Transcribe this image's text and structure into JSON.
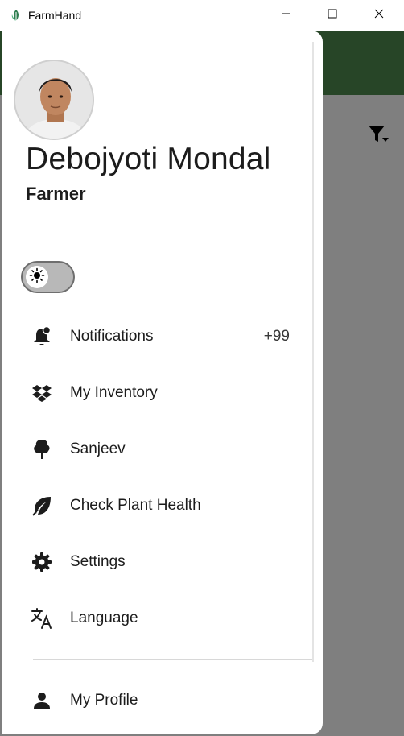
{
  "window": {
    "title": "FarmHand",
    "app_icon": "leaf-icon",
    "controls": [
      "minimize-icon",
      "maximize-icon",
      "close-icon"
    ]
  },
  "colors": {
    "header_green": "#2d6a2d",
    "scrim": "rgba(0,0,0,0.5)",
    "text": "#1c1c1c"
  },
  "background_app": {
    "filter_icon": "filter-icon"
  },
  "drawer": {
    "user": {
      "name": "Debojyoti Mondal",
      "role": "Farmer"
    },
    "theme_toggle": {
      "icon": "sun-icon",
      "state": "light"
    },
    "menu": [
      {
        "label": "Notifications",
        "icon": "bell-icon",
        "badge": "+99"
      },
      {
        "label": "My Inventory",
        "icon": "dropbox-icon",
        "badge": ""
      },
      {
        "label": "Sanjeev",
        "icon": "tree-icon",
        "badge": ""
      },
      {
        "label": "Check Plant Health",
        "icon": "leaf-icon",
        "badge": ""
      },
      {
        "label": "Settings",
        "icon": "gear-icon",
        "badge": ""
      },
      {
        "label": "Language",
        "icon": "translate-icon",
        "badge": ""
      }
    ],
    "footer_item": {
      "label": "My Profile",
      "icon": "person-icon"
    }
  }
}
